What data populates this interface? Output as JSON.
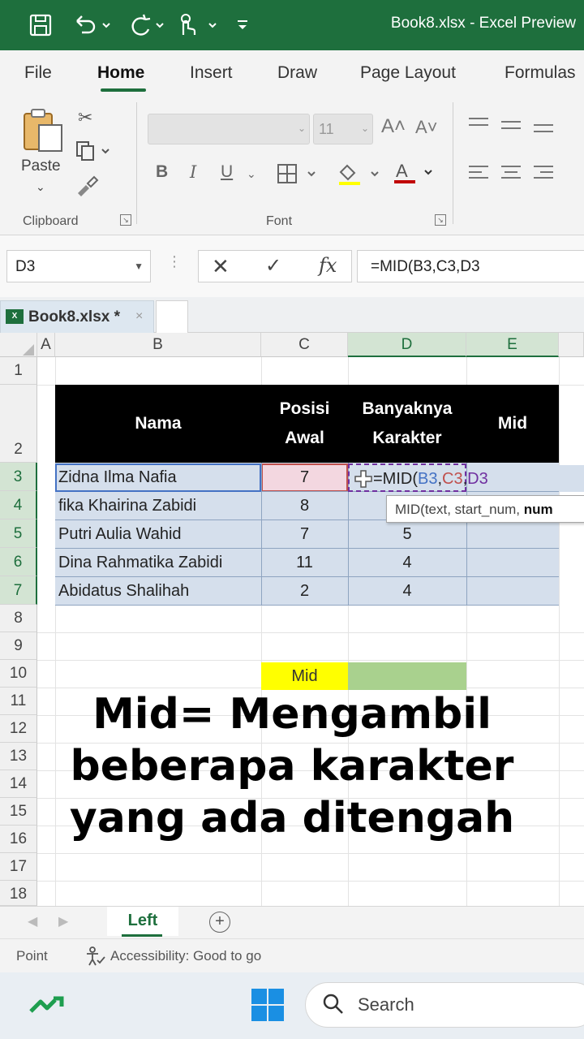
{
  "titlebar": {
    "title": "Book8.xlsx  -  Excel Preview",
    "icons": [
      "save-icon",
      "undo-icon",
      "redo-icon",
      "touch-mode-icon",
      "customize-icon"
    ]
  },
  "ribbon": {
    "tabs": [
      "File",
      "Home",
      "Insert",
      "Draw",
      "Page Layout",
      "Formulas"
    ],
    "active_tab": "Home",
    "paste_label": "Paste",
    "clipboard_label": "Clipboard",
    "font_label": "Font",
    "font_size": "11",
    "bold": "B",
    "italic": "I",
    "underline": "U",
    "grow_font": "A˄",
    "shrink_font": "A˅",
    "font_color": "A"
  },
  "formula_bar": {
    "name_box": "D3",
    "cancel": "✕",
    "enter": "✓",
    "fx": "fx",
    "formula": "=MID(B3,C3,D3"
  },
  "workbook_tab": {
    "label": "Book8.xlsx *",
    "close": "×"
  },
  "grid": {
    "columns": [
      "A",
      "B",
      "C",
      "D",
      "E"
    ],
    "rows": [
      "1",
      "2",
      "3",
      "4",
      "5",
      "6",
      "7",
      "8",
      "9",
      "10",
      "11",
      "12",
      "13",
      "14",
      "15",
      "16",
      "17",
      "18"
    ],
    "headers": {
      "nama": "Nama",
      "posisi_line1": "Posisi",
      "posisi_line2": "Awal",
      "banyak_line1": "Banyaknya",
      "banyak_line2": "Karakter",
      "mid": "Mid"
    },
    "data": [
      {
        "nama": "Zidna Ilma Nafia",
        "posisi": "7",
        "banyak": ""
      },
      {
        "nama": "fika Khairina Zabidi",
        "posisi": "8",
        "banyak": ""
      },
      {
        "nama": "Putri Aulia Wahid",
        "posisi": "7",
        "banyak": "5"
      },
      {
        "nama": "Dina Rahmatika Zabidi",
        "posisi": "11",
        "banyak": "4"
      },
      {
        "nama": "Abidatus Shalihah",
        "posisi": "2",
        "banyak": "4"
      }
    ],
    "edit": {
      "prefix": "=MID(",
      "ref_b": "B3",
      "comma1": ",",
      "ref_c": "C3",
      "comma2": ",",
      "ref_d": "D3"
    },
    "tooltip": {
      "text": "MID(text, start_num, ",
      "bold": "num"
    },
    "mid_label": "Mid"
  },
  "overlay_text": {
    "line1": "Mid= Mengambil",
    "line2": "beberapa karakter",
    "line3": "yang ada ditengah"
  },
  "sheet_tabs": {
    "active": "Left",
    "add": "+"
  },
  "status": {
    "mode": "Point",
    "accessibility": "Accessibility: Good to go"
  },
  "taskbar": {
    "search_placeholder": "Search"
  },
  "colors": {
    "excel_green": "#1e6f3d",
    "header_band": "#000000",
    "table_fill": "#d5dfec",
    "mid_label_fill": "#ffff00",
    "mid_result_fill": "#a9d18e"
  }
}
